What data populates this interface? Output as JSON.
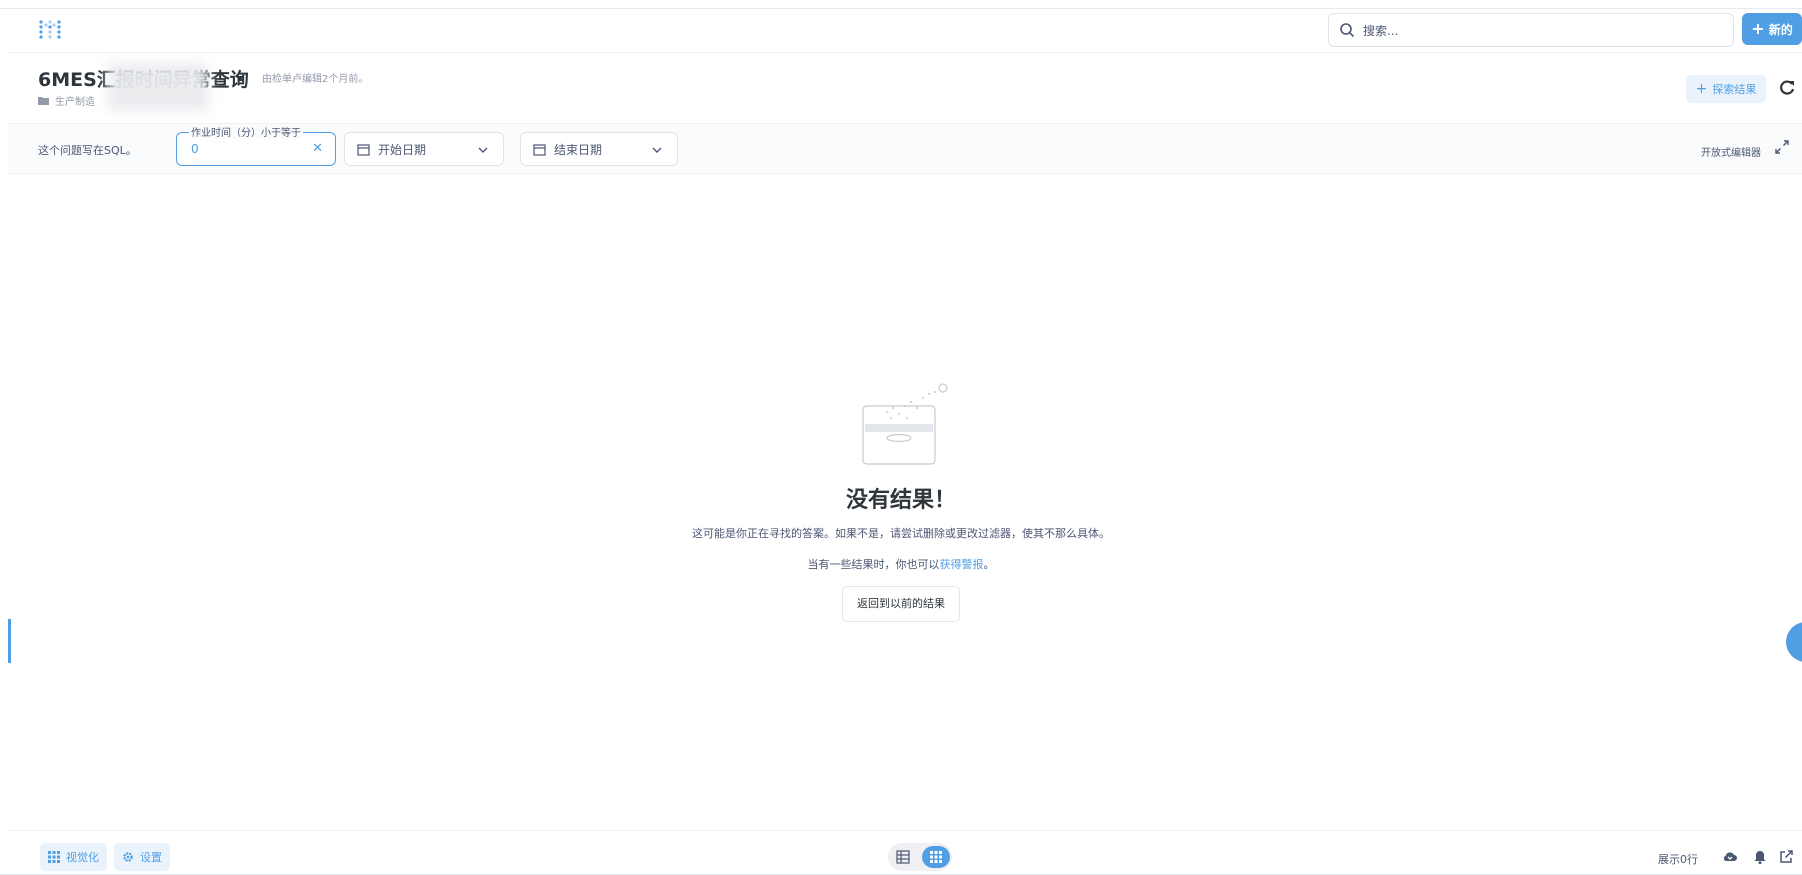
{
  "topnav": {
    "search_placeholder": "搜索...",
    "new_label": "新的"
  },
  "header": {
    "title": "6MES汇报时间异常查询",
    "edited_note": "由检单卢编辑2个月前。",
    "collection": "生产制造",
    "explore_label": "探索结果"
  },
  "filters": {
    "sql_note": "这个问题写在SQL。",
    "param_label": "作业时间（分）小于等于",
    "param_value": "0",
    "start_date": "开始日期",
    "end_date": "结束日期",
    "editor_link": "开放式编辑器"
  },
  "empty": {
    "title": "没有结果！",
    "description": "这可能是你正在寻找的答案。如果不是，请尝试删除或更改过滤器，使其不那么具体。",
    "alert_prefix": "当有一些结果时，你也可以",
    "alert_link": "获得警报",
    "alert_suffix": "。",
    "back_label": "返回到以前的结果"
  },
  "footer": {
    "visualize_label": "视觉化",
    "settings_label": "设置",
    "rows_shown": "展示0行"
  },
  "colors": {
    "brand": "#509ee3",
    "text_dark": "#2e353b",
    "text_medium": "#4c5773",
    "border": "#dfe3e8"
  }
}
